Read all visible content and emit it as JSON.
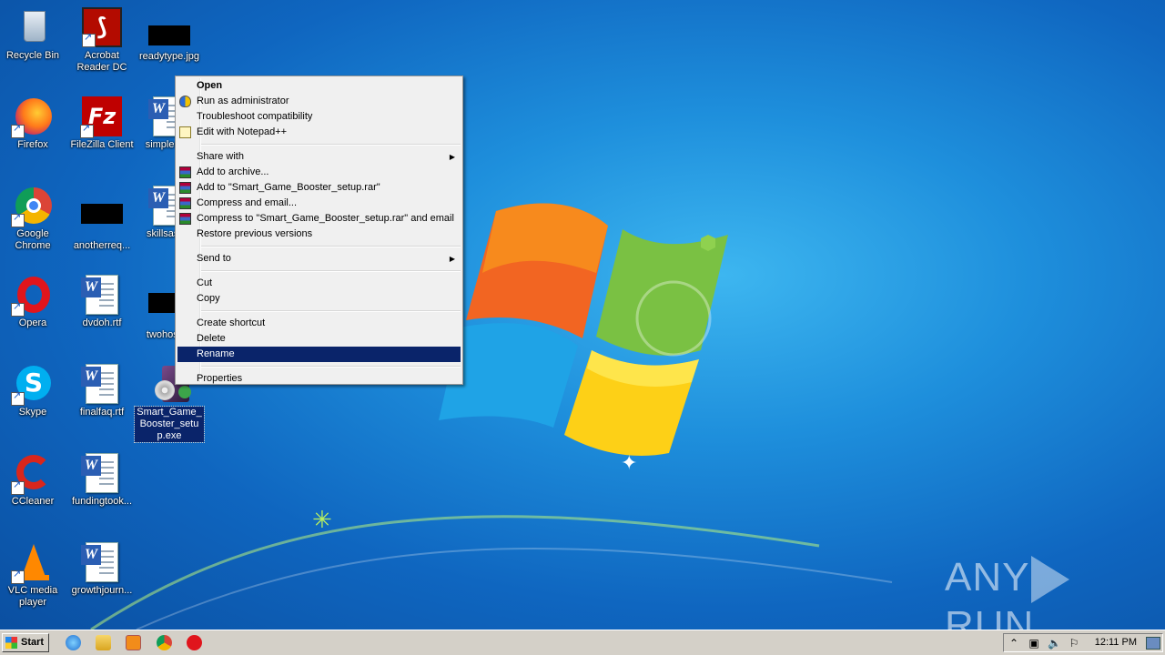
{
  "desktop": {
    "icons": [
      {
        "label": "Recycle Bin"
      },
      {
        "label": "Acrobat Reader DC"
      },
      {
        "label": "readytype.jpg"
      },
      {
        "label": "Firefox"
      },
      {
        "label": "FileZilla Client"
      },
      {
        "label": "simplesa..."
      },
      {
        "label": "Google Chrome"
      },
      {
        "label": "anotherreq..."
      },
      {
        "label": "skillsass..."
      },
      {
        "label": "Opera"
      },
      {
        "label": "dvdoh.rtf"
      },
      {
        "label": "twohosp..."
      },
      {
        "label": "Skype"
      },
      {
        "label": "finalfaq.rtf"
      },
      {
        "label": "Smart_Game_Booster_setup.exe"
      },
      {
        "label": "CCleaner"
      },
      {
        "label": "fundingtook..."
      },
      {
        "label": "VLC media player"
      },
      {
        "label": "growthjourn..."
      }
    ]
  },
  "context_menu": {
    "items": [
      {
        "label": "Open"
      },
      {
        "label": "Run as administrator"
      },
      {
        "label": "Troubleshoot compatibility"
      },
      {
        "label": "Edit with Notepad++"
      },
      {
        "label": "Share with"
      },
      {
        "label": "Add to archive..."
      },
      {
        "label": "Add to \"Smart_Game_Booster_setup.rar\""
      },
      {
        "label": "Compress and email..."
      },
      {
        "label": "Compress to \"Smart_Game_Booster_setup.rar\" and email"
      },
      {
        "label": "Restore previous versions"
      },
      {
        "label": "Send to"
      },
      {
        "label": "Cut"
      },
      {
        "label": "Copy"
      },
      {
        "label": "Create shortcut"
      },
      {
        "label": "Delete"
      },
      {
        "label": "Rename"
      },
      {
        "label": "Properties"
      }
    ],
    "highlighted": "Rename"
  },
  "taskbar": {
    "start_label": "Start",
    "clock": "12:11 PM"
  },
  "watermark": {
    "left": "ANY",
    "right": "RUN"
  },
  "colors": {
    "selection": "#0a246a",
    "taskbar": "#d4d0c8",
    "menu_bg": "#f0f0f0"
  }
}
